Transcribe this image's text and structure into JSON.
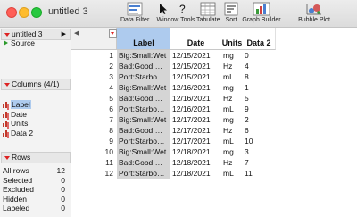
{
  "window": {
    "title": "untitled 3"
  },
  "toolbar": [
    {
      "label": "Data Filter",
      "icon": "data-filter-icon"
    },
    {
      "label": "Window Tools",
      "icon": "cursor-icon"
    },
    {
      "label": "Tabulate",
      "icon": "tabulate-icon"
    },
    {
      "label": "Sort",
      "icon": "sort-icon"
    },
    {
      "label": "Graph Builder",
      "icon": "graph-builder-icon"
    },
    {
      "label": "Bubble Plot",
      "icon": "bubble-plot-icon"
    }
  ],
  "table_panel": {
    "title": "untitled 3",
    "source": "Source"
  },
  "columns_panel": {
    "title": "Columns (4/1)",
    "items": [
      "Label",
      "Date",
      "Units",
      "Data 2"
    ]
  },
  "rows_panel": {
    "title": "Rows",
    "stats": [
      {
        "label": "All rows",
        "value": "12"
      },
      {
        "label": "Selected",
        "value": "0"
      },
      {
        "label": "Excluded",
        "value": "0"
      },
      {
        "label": "Hidden",
        "value": "0"
      },
      {
        "label": "Labeled",
        "value": "0"
      }
    ]
  },
  "table": {
    "headers": [
      "Label",
      "Date",
      "Units",
      "Data 2"
    ],
    "selected_column": "Label",
    "rows": [
      [
        "1",
        "Big:Small:Wet",
        "12/15/2021",
        "mg",
        "0"
      ],
      [
        "2",
        "Bad:Good:…",
        "12/15/2021",
        "Hz",
        "4"
      ],
      [
        "3",
        "Port:Starbo…",
        "12/15/2021",
        "mL",
        "8"
      ],
      [
        "4",
        "Big:Small:Wet",
        "12/16/2021",
        "mg",
        "1"
      ],
      [
        "5",
        "Bad:Good:…",
        "12/16/2021",
        "Hz",
        "5"
      ],
      [
        "6",
        "Port:Starbo…",
        "12/16/2021",
        "mL",
        "9"
      ],
      [
        "7",
        "Big:Small:Wet",
        "12/17/2021",
        "mg",
        "2"
      ],
      [
        "8",
        "Bad:Good:…",
        "12/17/2021",
        "Hz",
        "6"
      ],
      [
        "9",
        "Port:Starbo…",
        "12/17/2021",
        "mL",
        "10"
      ],
      [
        "10",
        "Big:Small:Wet",
        "12/18/2021",
        "mg",
        "3"
      ],
      [
        "11",
        "Bad:Good:…",
        "12/18/2021",
        "Hz",
        "7"
      ],
      [
        "12",
        "Port:Starbo…",
        "12/18/2021",
        "mL",
        "11"
      ]
    ]
  }
}
